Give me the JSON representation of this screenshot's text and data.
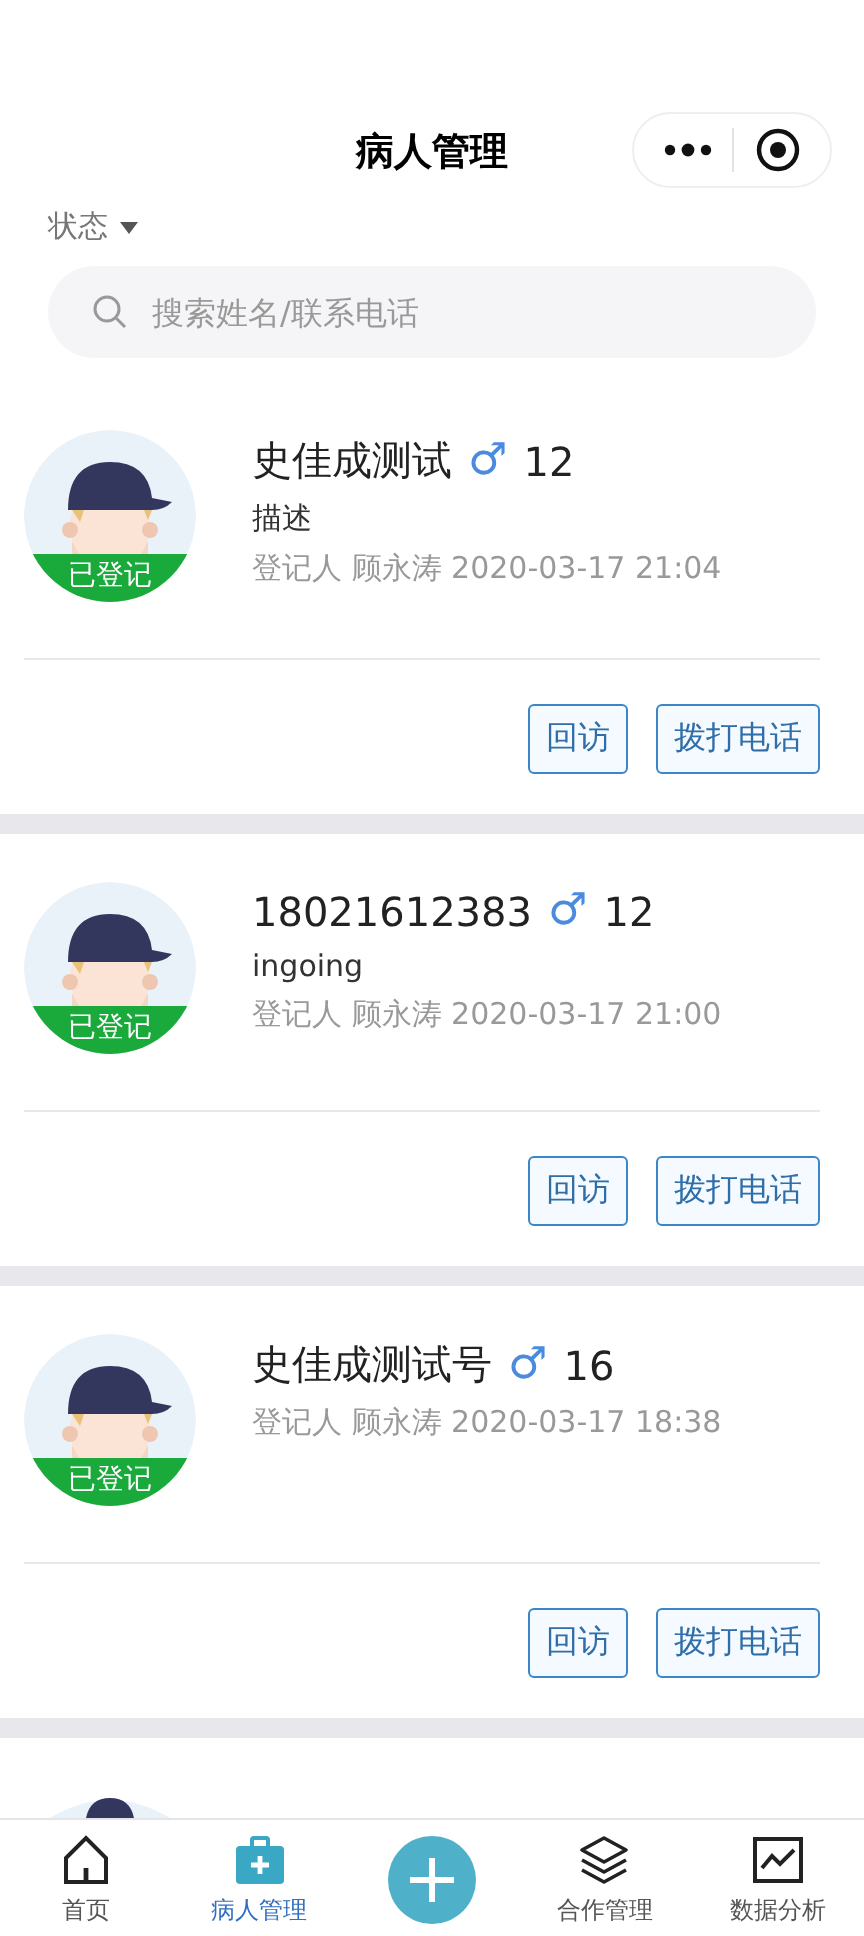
{
  "header": {
    "title": "病人管理"
  },
  "filter": {
    "label": "状态"
  },
  "search": {
    "placeholder": "搜索姓名/联系电话"
  },
  "patients": [
    {
      "name": "史佳成测试",
      "gender": "♂",
      "age": "12",
      "status": "已登记",
      "description": "描述",
      "registrar": "登记人 顾永涛 2020-03-17 21:04",
      "actions": [
        "回访",
        "拨打电话"
      ]
    },
    {
      "name": "18021612383",
      "gender": "♂",
      "age": "12",
      "status": "已登记",
      "description": "ingoing",
      "registrar": "登记人 顾永涛 2020-03-17 21:00",
      "actions": [
        "回访",
        "拨打电话"
      ]
    },
    {
      "name": "史佳成测试号",
      "gender": "♂",
      "age": "16",
      "status": "已登记",
      "registrar": "登记人 顾永涛 2020-03-17 18:38",
      "actions": [
        "回访",
        "拨打电话"
      ]
    }
  ],
  "tabbar": [
    {
      "kind": "home",
      "label": "首页",
      "selected": false
    },
    {
      "kind": "kit",
      "label": "病人管理",
      "selected": true
    },
    {
      "kind": "add"
    },
    {
      "kind": "layers",
      "label": "合作管理",
      "selected": false
    },
    {
      "kind": "chart",
      "label": "数据分析",
      "selected": false
    }
  ]
}
